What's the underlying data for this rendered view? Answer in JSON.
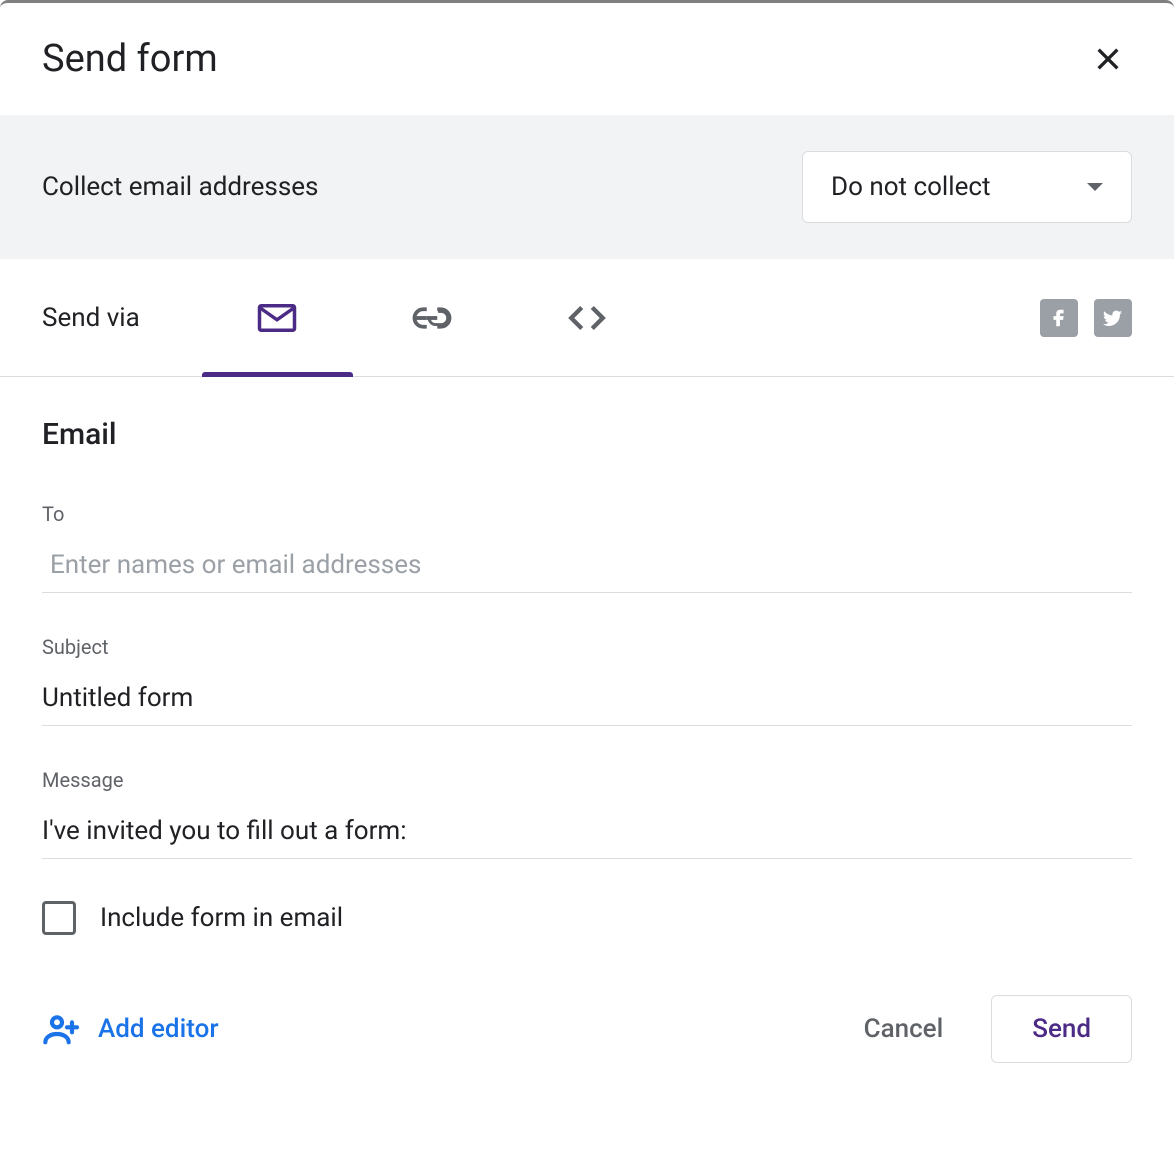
{
  "dialog": {
    "title": "Send form"
  },
  "collect": {
    "label": "Collect email addresses",
    "selected": "Do not collect"
  },
  "send_via": {
    "label": "Send via"
  },
  "email": {
    "section_title": "Email",
    "to_label": "To",
    "to_placeholder": "Enter names or email addresses",
    "to_value": "",
    "subject_label": "Subject",
    "subject_value": "Untitled form",
    "message_label": "Message",
    "message_value": "I've invited you to fill out a form:",
    "include_form_label": "Include form in email"
  },
  "footer": {
    "add_editor": "Add editor",
    "cancel": "Cancel",
    "send": "Send"
  }
}
